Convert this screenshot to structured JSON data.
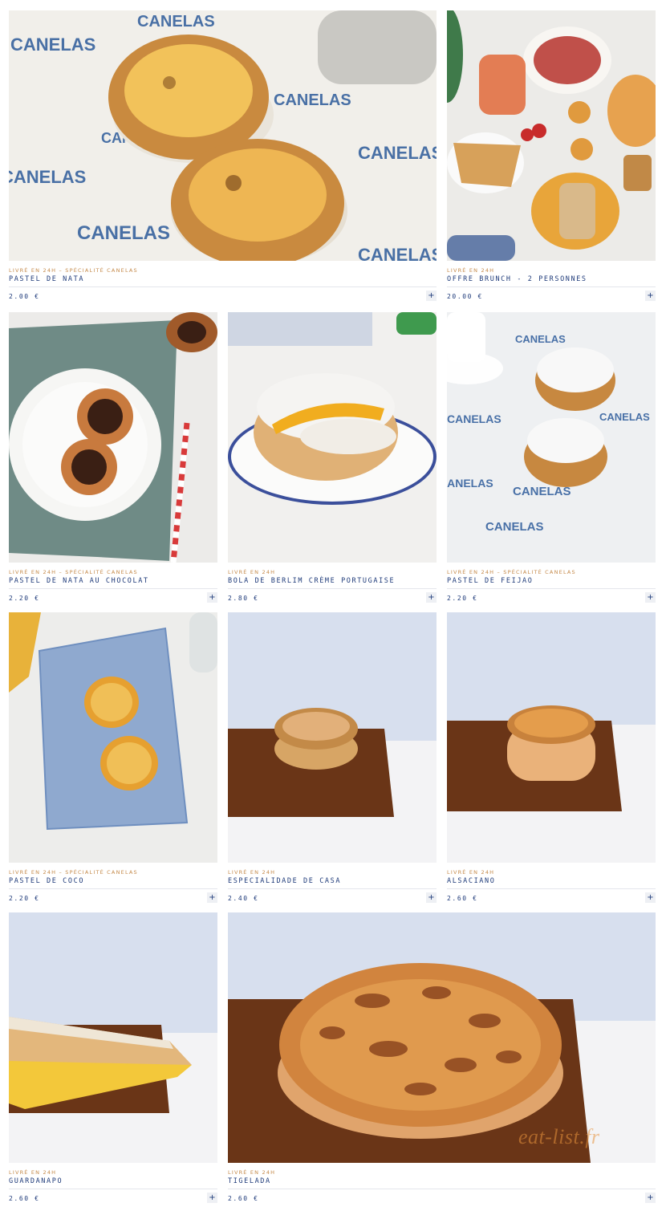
{
  "colors": {
    "tag": "#c58a4a",
    "text": "#1f3b7a",
    "rule": "#e4e6ec",
    "button_bg": "#eef0f4"
  },
  "photo_brand_text": "CANELAS",
  "watermark": "eat-list.fr",
  "products": [
    {
      "tag": "Livré en 24h – Spécialité Canelas",
      "name": "Pastel de Nata",
      "price": "2.00 €",
      "add_label": "+"
    },
    {
      "tag": "Livré en 24h",
      "name": "Offre Brunch - 2 personnes",
      "price": "20.00 €",
      "add_label": "+"
    },
    {
      "tag": "Livré en 24h – Spécialité Canelas",
      "name": "Pastel de Nata au chocolat",
      "price": "2.20 €",
      "add_label": "+"
    },
    {
      "tag": "Livré en 24h",
      "name": "Bola de Berlim crème portugaise",
      "price": "2.80 €",
      "add_label": "+"
    },
    {
      "tag": "Livré en 24h – Spécialité Canelas",
      "name": "Pastel de Feijao",
      "price": "2.20 €",
      "add_label": "+"
    },
    {
      "tag": "Livré en 24h – Spécialité Canelas",
      "name": "Pastel de Coco",
      "price": "2.20 €",
      "add_label": "+"
    },
    {
      "tag": "Livré en 24h",
      "name": "Especialidade de Casa",
      "price": "2.40 €",
      "add_label": "+"
    },
    {
      "tag": "Livré en 24h",
      "name": "Alsaciano",
      "price": "2.60 €",
      "add_label": "+"
    },
    {
      "tag": "Livré en 24h",
      "name": "Guardanapo",
      "price": "2.60 €",
      "add_label": "+"
    },
    {
      "tag": "Livré en 24h",
      "name": "Tigelada",
      "price": "2.60 €",
      "add_label": "+"
    }
  ]
}
